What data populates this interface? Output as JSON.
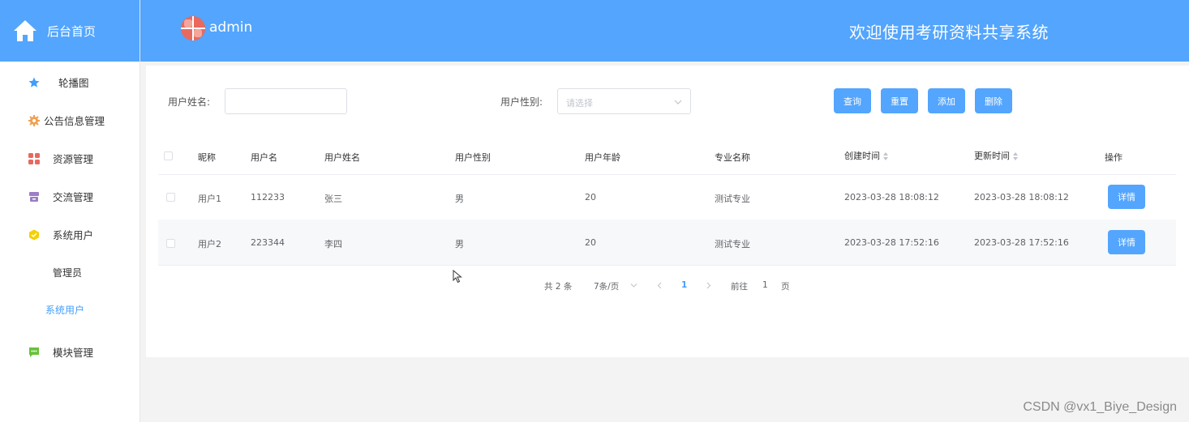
{
  "sidebar": {
    "home_label": "后台首页",
    "items": [
      {
        "label": "轮播图",
        "icon": "star-icon",
        "color": "#409eff"
      },
      {
        "label": "公告信息管理",
        "icon": "gear-icon",
        "color": "#f0a050"
      },
      {
        "label": "资源管理",
        "icon": "grid-icon",
        "color": "#e8695e"
      },
      {
        "label": "交流管理",
        "icon": "box-icon",
        "color": "#9b7dc8"
      },
      {
        "label": "系统用户",
        "icon": "cube-icon",
        "color": "#f5d000"
      }
    ],
    "sub_items": [
      {
        "label": "管理员"
      },
      {
        "label": "系统用户",
        "active": true
      }
    ],
    "last_item": {
      "label": "模块管理",
      "icon": "chat-icon",
      "color": "#67c23a"
    }
  },
  "header": {
    "user": "admin",
    "welcome": "欢迎使用考研资料共享系统"
  },
  "search": {
    "name_label": "用户姓名:",
    "name_value": "",
    "gender_label": "用户性别:",
    "gender_placeholder": "请选择",
    "buttons": [
      "查询",
      "重置",
      "添加",
      "删除"
    ]
  },
  "table": {
    "headers": [
      "昵称",
      "用户名",
      "用户姓名",
      "用户性别",
      "用户年龄",
      "专业名称",
      "创建时间",
      "更新时间",
      "操作"
    ],
    "rows": [
      {
        "nickname": "用户1",
        "username": "112233",
        "name": "张三",
        "gender": "男",
        "age": "20",
        "major": "测试专业",
        "created": "2023-03-28 18:08:12",
        "updated": "2023-03-28 18:08:12",
        "action": "详情"
      },
      {
        "nickname": "用户2",
        "username": "223344",
        "name": "李四",
        "gender": "男",
        "age": "20",
        "major": "测试专业",
        "created": "2023-03-28 17:52:16",
        "updated": "2023-03-28 17:52:16",
        "action": "详情"
      }
    ]
  },
  "pagination": {
    "total": "共 2 条",
    "page_size": "7条/页",
    "current_page": "1",
    "goto_prefix": "前往",
    "goto_value": "1",
    "goto_suffix": "页"
  },
  "watermark": "CSDN @vx1_Biye_Design",
  "colors": {
    "accent": "#53a5fd",
    "active_text": "#409eff"
  }
}
